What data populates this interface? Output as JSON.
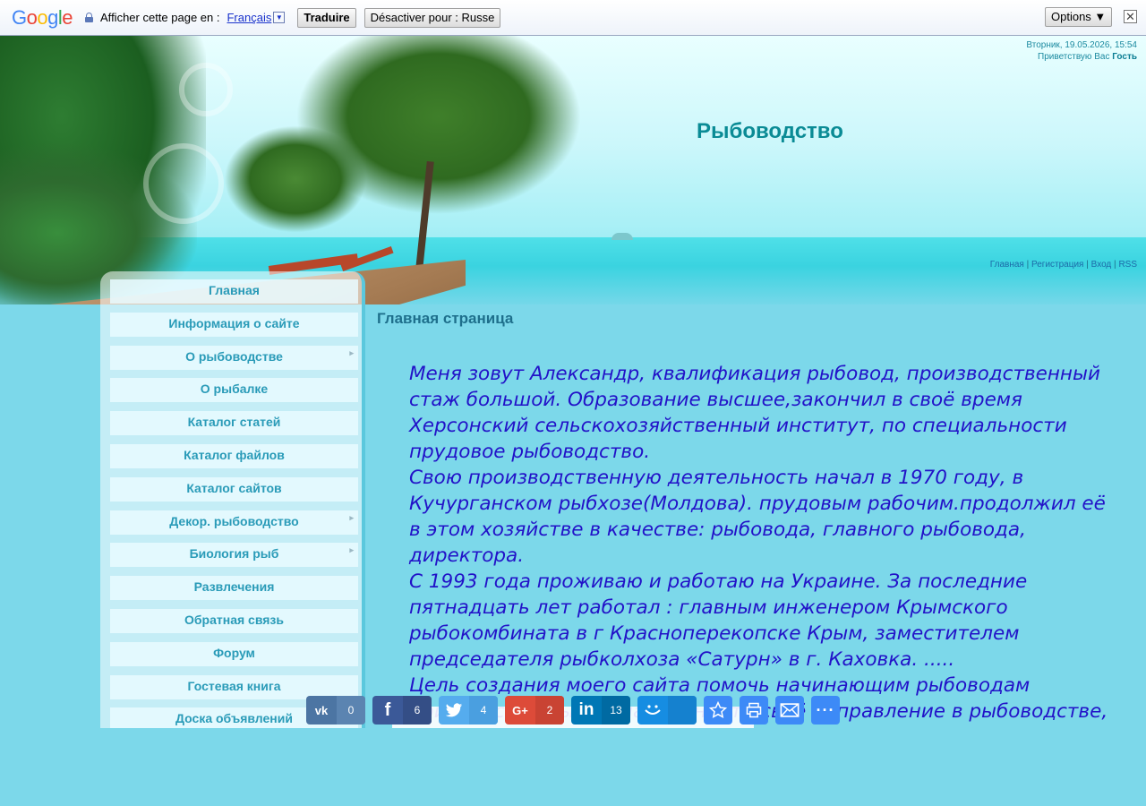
{
  "translate_bar": {
    "logo_letters": [
      "G",
      "o",
      "o",
      "g",
      "l",
      "e"
    ],
    "label": "Afficher cette page en :",
    "language": "Français",
    "dropdown_glyph": "▼",
    "translate_button": "Traduire",
    "disable_button": "Désactiver pour : Russe",
    "options_button": "Options ▼",
    "close_glyph": "✕"
  },
  "header": {
    "datetime": "Вторник, 19.05.2026, 15:54",
    "greeting_prefix": "Приветствую Вас",
    "greeting_user": "Гость",
    "site_title": "Рыбоводство",
    "top_links": [
      "Главная",
      "Регистрация",
      "Вход",
      "RSS"
    ],
    "separator": "|"
  },
  "menu": [
    {
      "label": "Главная",
      "submenu": false
    },
    {
      "label": "Информация о сайте",
      "submenu": false
    },
    {
      "label": "О рыбоводстве",
      "submenu": true
    },
    {
      "label": "О рыбалке",
      "submenu": false
    },
    {
      "label": "Каталог статей",
      "submenu": false
    },
    {
      "label": "Каталог файлов",
      "submenu": false
    },
    {
      "label": "Каталог сайтов",
      "submenu": false
    },
    {
      "label": "Декор. рыбоводство",
      "submenu": true
    },
    {
      "label": "Биология рыб",
      "submenu": true
    },
    {
      "label": "Развлечения",
      "submenu": false
    },
    {
      "label": "Обратная связь",
      "submenu": false
    },
    {
      "label": "Форум",
      "submenu": false
    },
    {
      "label": "Гостевая книга",
      "submenu": false
    },
    {
      "label": "Доска объявлений",
      "submenu": false
    }
  ],
  "content": {
    "heading": "Главная страница",
    "paragraphs": [
      "Меня зовут Александр, квалификация рыбовод, производственный стаж большой. Образование высшее,закончил в своё время Херсонский сельскохозяйственный институт, по специальности прудовое рыбоводство.",
      "Свою производственную деятельность начал в 1970 году, в Кучурганском рыбхозе(Молдова). прудовым рабочим.продолжил её в этом хозяйстве в качестве: рыбовода, главного рыбовода, директора.",
      "С 1993 года проживаю и работаю на Украине. За последние пятнадцать лет работал : главным инженером Крымского рыбокомбината в г Красноперекопске Крым, заместителем председателя рыбколхоза «Сатурн» в г. Каховка. .....",
      "Цель создания моего сайта помочь начинающим рыбоводам приобрести опыт и знания, найти своё направление в рыбоводстве,"
    ]
  },
  "share_bar": {
    "buttons": [
      {
        "name": "vk",
        "icon": "vk",
        "count": "0",
        "color": "#4c75a3"
      },
      {
        "name": "facebook",
        "icon": "f",
        "count": "6",
        "color": "#3b5998"
      },
      {
        "name": "twitter",
        "icon": "twitter-bird",
        "count": "4",
        "color": "#55acee"
      },
      {
        "name": "google-plus",
        "icon": "G+",
        "count": "2",
        "color": "#dd4b39"
      },
      {
        "name": "linkedin",
        "icon": "in",
        "count": "13",
        "color": "#0077b5"
      },
      {
        "name": "moi-mir",
        "icon": "smile",
        "count": "",
        "color": "#168de2"
      },
      {
        "name": "bookmark",
        "icon": "star",
        "count": "",
        "color": "#3d8af7"
      },
      {
        "name": "print",
        "icon": "printer",
        "count": "",
        "color": "#3d8af7"
      },
      {
        "name": "email",
        "icon": "envelope",
        "count": "",
        "color": "#3d8af7"
      },
      {
        "name": "more",
        "icon": "ellipsis",
        "count": "",
        "color": "#3d8af7"
      }
    ]
  }
}
